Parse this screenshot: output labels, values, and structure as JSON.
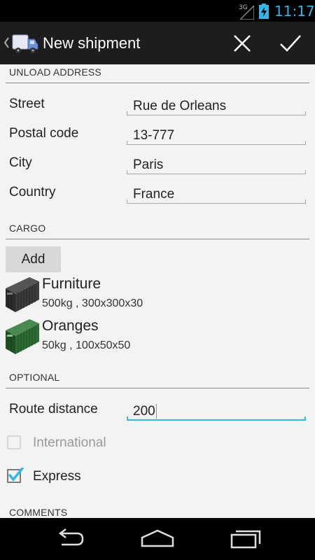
{
  "status_bar": {
    "network": "3G",
    "time": "11:17",
    "accent": "#33b5e5"
  },
  "action_bar": {
    "title": "New shipment",
    "cancel_icon": "close-icon",
    "confirm_icon": "check-icon",
    "app_icon": "truck-icon"
  },
  "unload_address": {
    "header": "UNLOAD ADDRESS",
    "fields": [
      {
        "label": "Street",
        "value": "Rue de Orleans"
      },
      {
        "label": "Postal code",
        "value": "13-777"
      },
      {
        "label": "City",
        "value": "Paris"
      },
      {
        "label": "Country",
        "value": "France"
      }
    ]
  },
  "cargo": {
    "header": "CARGO",
    "add_label": "Add",
    "items": [
      {
        "name": "Furniture",
        "detail": "500kg , 300x300x30",
        "color": "#333333",
        "icon": "container-icon"
      },
      {
        "name": "Oranges",
        "detail": "50kg , 100x50x50",
        "color": "#2e6b35",
        "icon": "container-icon"
      }
    ]
  },
  "optional": {
    "header": "OPTIONAL",
    "route_distance": {
      "label": "Route distance",
      "value": "200"
    },
    "international": {
      "label": "International",
      "checked": false,
      "enabled": false
    },
    "express": {
      "label": "Express",
      "checked": true,
      "enabled": true
    }
  },
  "comments": {
    "header": "COMMENTS"
  },
  "nav_bar": {
    "back_icon": "back-icon",
    "home_icon": "home-icon",
    "recents_icon": "recents-icon"
  }
}
